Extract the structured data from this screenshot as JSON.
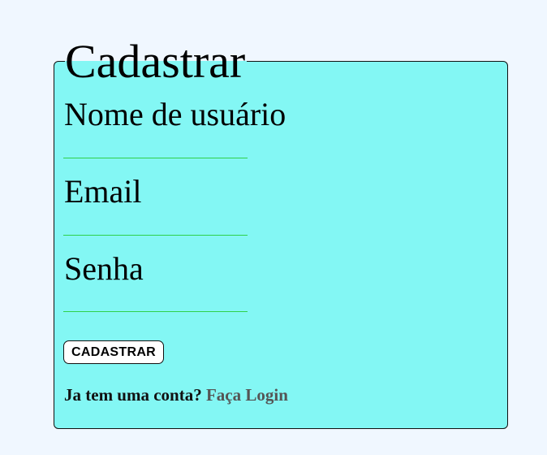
{
  "form": {
    "title": "Cadastrar",
    "fields": [
      {
        "label": "Nome de usuário",
        "value": "",
        "placeholder": ""
      },
      {
        "label": "Email",
        "value": "",
        "placeholder": ""
      },
      {
        "label": "Senha",
        "value": "",
        "placeholder": ""
      }
    ],
    "submit_label": "CADASTRAR",
    "login_prompt": "Ja tem uma conta?",
    "login_link": "Faça Login"
  },
  "colors": {
    "page_background": "#f0f7ff",
    "panel_background": "#83f7f4",
    "input_underline": "#2fd14a",
    "link": "#555555"
  }
}
